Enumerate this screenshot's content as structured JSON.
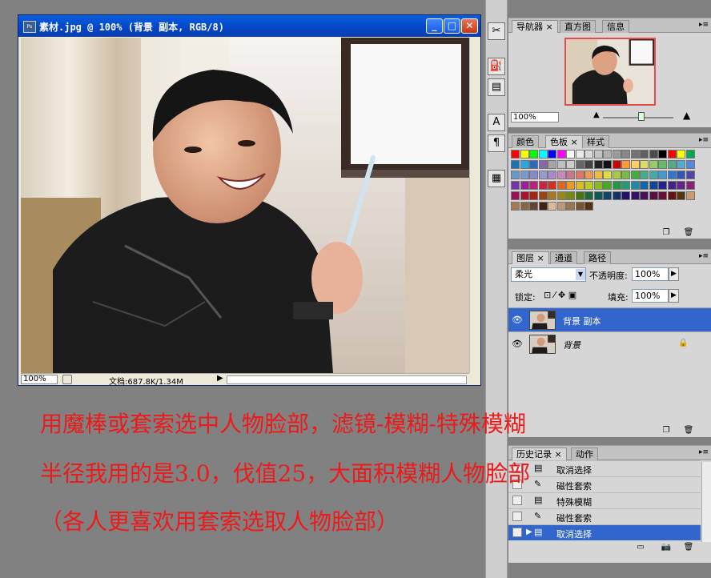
{
  "document": {
    "title": "素材.jpg @ 100% (背景 副本, RGB/8)",
    "title_icon": "Ps",
    "zoom": "100%",
    "size_info": "文档:687.8K/1.34M",
    "buttons": {
      "minimize": "_",
      "maximize": "□",
      "close": "✕"
    }
  },
  "tools": [
    "✂",
    "⛽",
    "▤",
    "A",
    "¶",
    "▦"
  ],
  "navigator": {
    "tabs": [
      {
        "label": "导航器 ×",
        "active": true
      },
      {
        "label": "直方图",
        "active": false
      },
      {
        "label": "信息",
        "active": false
      }
    ],
    "zoom": "100%",
    "thumb_border_color": "#e24b4b"
  },
  "swatches_panel": {
    "tabs": [
      {
        "label": "颜色",
        "active": false
      },
      {
        "label": "色板 ×",
        "active": true
      },
      {
        "label": "样式",
        "active": false
      }
    ],
    "colors": [
      "#ff0000",
      "#ffff00",
      "#00ff00",
      "#00ffff",
      "#0000ff",
      "#ff00ff",
      "#ffffff",
      "#ebebeb",
      "#d7d7d7",
      "#c3c3c3",
      "#afafaf",
      "#9b9b9b",
      "#878787",
      "#737373",
      "#5f5f5f",
      "#4b4b4b",
      "#000000",
      "#ff0000",
      "#ffff00",
      "#00aa55",
      "#1e74b0",
      "#29a8e0",
      "#2a6bbd",
      "#8866aa",
      "#a6a6a6",
      "#bfbfbf",
      "#cccccc",
      "#666666",
      "#444444",
      "#222222",
      "#111111",
      "#cc0000",
      "#ff9933",
      "#ffcc66",
      "#dddd66",
      "#99cc66",
      "#66bb66",
      "#55aa88",
      "#55aacc",
      "#5588dd",
      "#6699cc",
      "#7799cc",
      "#8888cc",
      "#9999cc",
      "#aa88cc",
      "#cc88bb",
      "#cc7788",
      "#dd7766",
      "#ee9955",
      "#eebb44",
      "#dddd44",
      "#aacc44",
      "#77bb44",
      "#44aa44",
      "#44aa88",
      "#44aaaa",
      "#4499cc",
      "#3377cc",
      "#3355bb",
      "#5544aa",
      "#7733aa",
      "#992299",
      "#bb2277",
      "#cc2244",
      "#cc3322",
      "#dd6622",
      "#ee9922",
      "#ddbb22",
      "#bbcc22",
      "#88bb22",
      "#44aa22",
      "#229944",
      "#229977",
      "#2288aa",
      "#1166aa",
      "#114499",
      "#222288",
      "#442288",
      "#662288",
      "#882277",
      "#991155",
      "#aa1133",
      "#aa2211",
      "#994411",
      "#aa7722",
      "#998811",
      "#778811",
      "#447711",
      "#226633",
      "#115555",
      "#114466",
      "#113366",
      "#221166",
      "#331166",
      "#441155",
      "#551144",
      "#661133",
      "#661111",
      "#553311",
      "#cc9977",
      "#aa7755",
      "#886644",
      "#664433",
      "#442211",
      "#ddbb99",
      "#bb9977",
      "#997755",
      "#775533",
      "#553311"
    ]
  },
  "layers": {
    "tabs": [
      {
        "label": "图层 ×",
        "active": true
      },
      {
        "label": "通道",
        "active": false
      },
      {
        "label": "路径",
        "active": false
      }
    ],
    "blend_mode": "柔光",
    "opacity_label": "不透明度:",
    "opacity_value": "100%",
    "lock_label": "锁定:",
    "lock_icons": "⊡ ⁄ ✥ ▣",
    "fill_label": "填充:",
    "fill_value": "100%",
    "rows": [
      {
        "name": "背景 副本",
        "selected": true,
        "locked": false
      },
      {
        "name": "背景",
        "selected": false,
        "locked": true
      }
    ]
  },
  "history": {
    "tabs": [
      {
        "label": "历史记录 ×",
        "active": true
      },
      {
        "label": "动作",
        "active": false
      }
    ],
    "rows": [
      {
        "name": "取消选择",
        "selected": false
      },
      {
        "name": "磁性套索",
        "selected": false
      },
      {
        "name": "特殊模糊",
        "selected": false
      },
      {
        "name": "磁性套索",
        "selected": false
      },
      {
        "name": "取消选择",
        "selected": true
      }
    ]
  },
  "caption": {
    "line1": "用魔棒或套索选中人物脸部，滤镜-模糊-特殊模糊",
    "line2": "半径我用的是3.0，伐值25，大面积模糊人物脸部",
    "line3": "（各人更喜欢用套索选取人物脸部）",
    "color": "#ee1a1a"
  }
}
